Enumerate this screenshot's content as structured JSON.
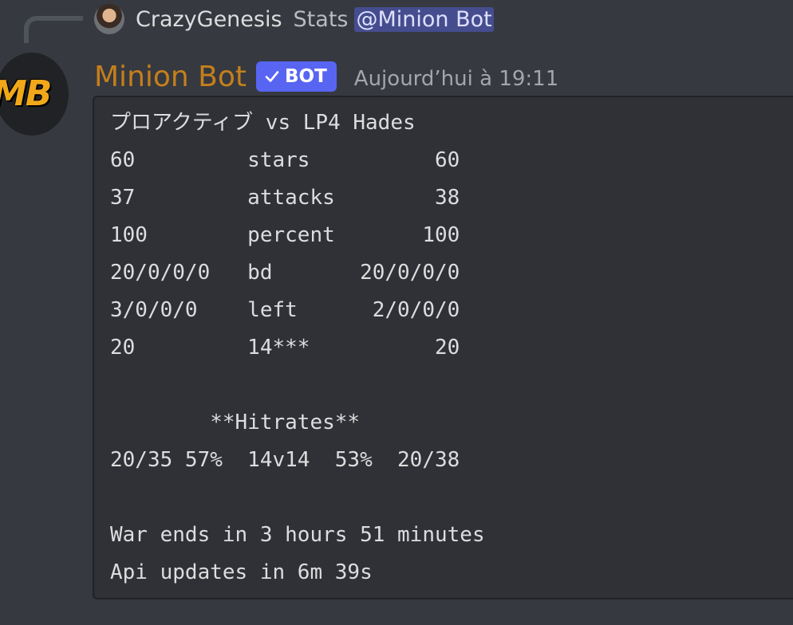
{
  "reply": {
    "author": "CrazyGenesis",
    "text": "Stats",
    "mention": "@Minion Bot"
  },
  "bot": {
    "avatar_text": "MB",
    "name": "Minion Bot",
    "tag_label": "BOT",
    "timestamp": "Aujourd’hui à 19:11"
  },
  "codeblock": {
    "lines": [
      "プロアクティブ vs LP4 Hades",
      "60         stars          60",
      "37         attacks        38",
      "100        percent       100",
      "20/0/0/0   bd       20/0/0/0",
      "3/0/0/0    left      2/0/0/0",
      "20         14***          20",
      "",
      "        **Hitrates**",
      "20/35 57%  14v14  53%  20/38",
      "",
      "War ends in 3 hours 51 minutes",
      "Api updates in 6m 39s"
    ]
  },
  "colors": {
    "background": "#36393f",
    "codeblock_bg": "#2f3136",
    "bot_name": "#c57f1c",
    "bot_tag": "#5865f2",
    "mention_bg": "#5865f2"
  }
}
